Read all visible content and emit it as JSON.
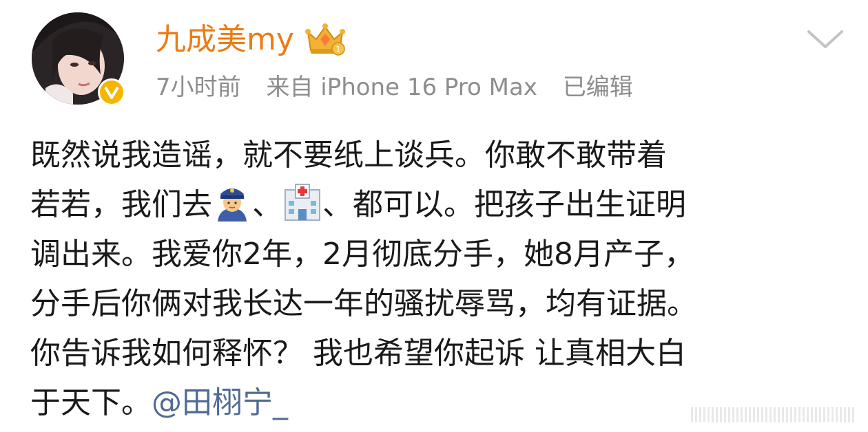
{
  "user": {
    "name": "九成美my",
    "verified_icon": "verified-v-icon",
    "member_badge_icon": "crown-badge-icon"
  },
  "meta": {
    "time": "7小时前",
    "source": "来自 iPhone 16 Pro Max",
    "edited": "已编辑"
  },
  "post": {
    "line1": "既然说我造谣，就不要纸上谈兵。你敢不敢带着",
    "line2_a": "若若，我们去",
    "line2_b": "、",
    "line2_c": "、都可以。把孩子出生证明",
    "line3": "调出来。我爱你2年，2月彻底分手，她8月产子，",
    "line4": "分手后你俩对我长达一年的骚扰辱骂，均有证据。",
    "line5": "你告诉我如何释怀？ 我也希望你起诉 让真相大白",
    "line6_a": "于天下。",
    "mention": "@田栩宁_",
    "emoji1": "police-officer-emoji",
    "emoji2": "hospital-emoji"
  },
  "colors": {
    "username": "#ef7a12",
    "meta": "#8d8d8d",
    "text": "#1a1a1a",
    "mention": "#4f6a95",
    "verified": "#f6b500"
  }
}
